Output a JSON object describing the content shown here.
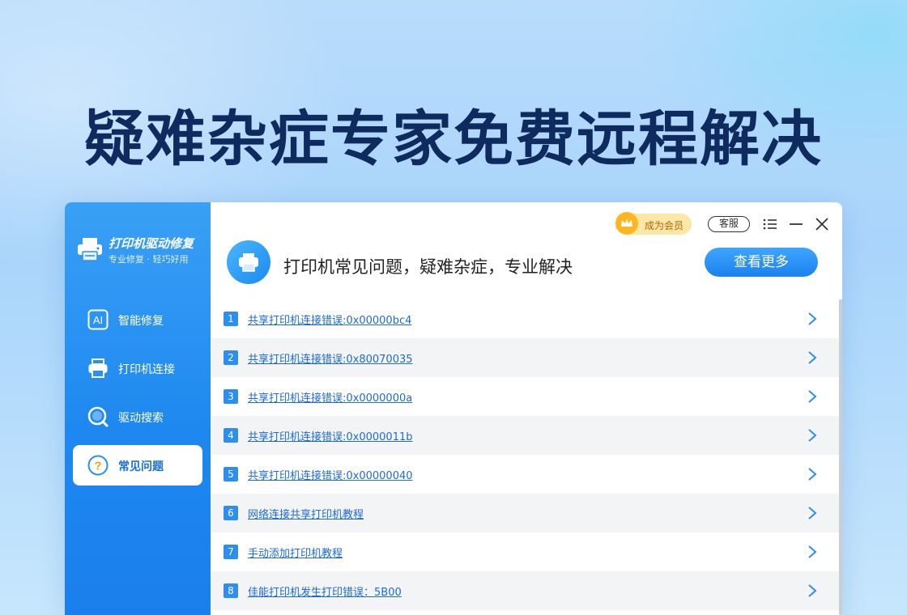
{
  "page": {
    "hero_title": "疑难杂症专家免费远程解决"
  },
  "sidebar": {
    "brand_name": "打印机驱动修复",
    "brand_subtitle": "专业修复 · 轻巧好用",
    "items": [
      {
        "label": "智能修复",
        "icon": "ai-icon",
        "active": false
      },
      {
        "label": "打印机连接",
        "icon": "printer-icon",
        "active": false
      },
      {
        "label": "驱动搜索",
        "icon": "search-icon",
        "active": false
      },
      {
        "label": "常见问题",
        "icon": "question-icon",
        "active": true
      }
    ]
  },
  "titlebar": {
    "vip_label": "成为会员",
    "service_label": "客服",
    "menu_icon": "menu-icon",
    "minimize_icon": "minimize-icon",
    "close_icon": "close-icon"
  },
  "banner": {
    "text": "打印机常见问题，疑难杂症，专业解决",
    "more_button": "查看更多"
  },
  "faq": [
    {
      "num": "1",
      "title": "共享打印机连接错误:0x00000bc4"
    },
    {
      "num": "2",
      "title": "共享打印机连接错误:0x80070035"
    },
    {
      "num": "3",
      "title": "共享打印机连接错误:0x0000000a"
    },
    {
      "num": "4",
      "title": "共享打印机连接错误:0x0000011b"
    },
    {
      "num": "5",
      "title": "共享打印机连接错误:0x00000040"
    },
    {
      "num": "6",
      "title": "网络连接共享打印机教程"
    },
    {
      "num": "7",
      "title": "手动添加打印机教程"
    },
    {
      "num": "8",
      "title": "佳能打印机发生打印错误：5B00"
    }
  ],
  "colors": {
    "accent": "#1e88f0",
    "title": "#0e2a5e",
    "link": "#1d69d6",
    "vip_bg": "#fde7a6"
  }
}
